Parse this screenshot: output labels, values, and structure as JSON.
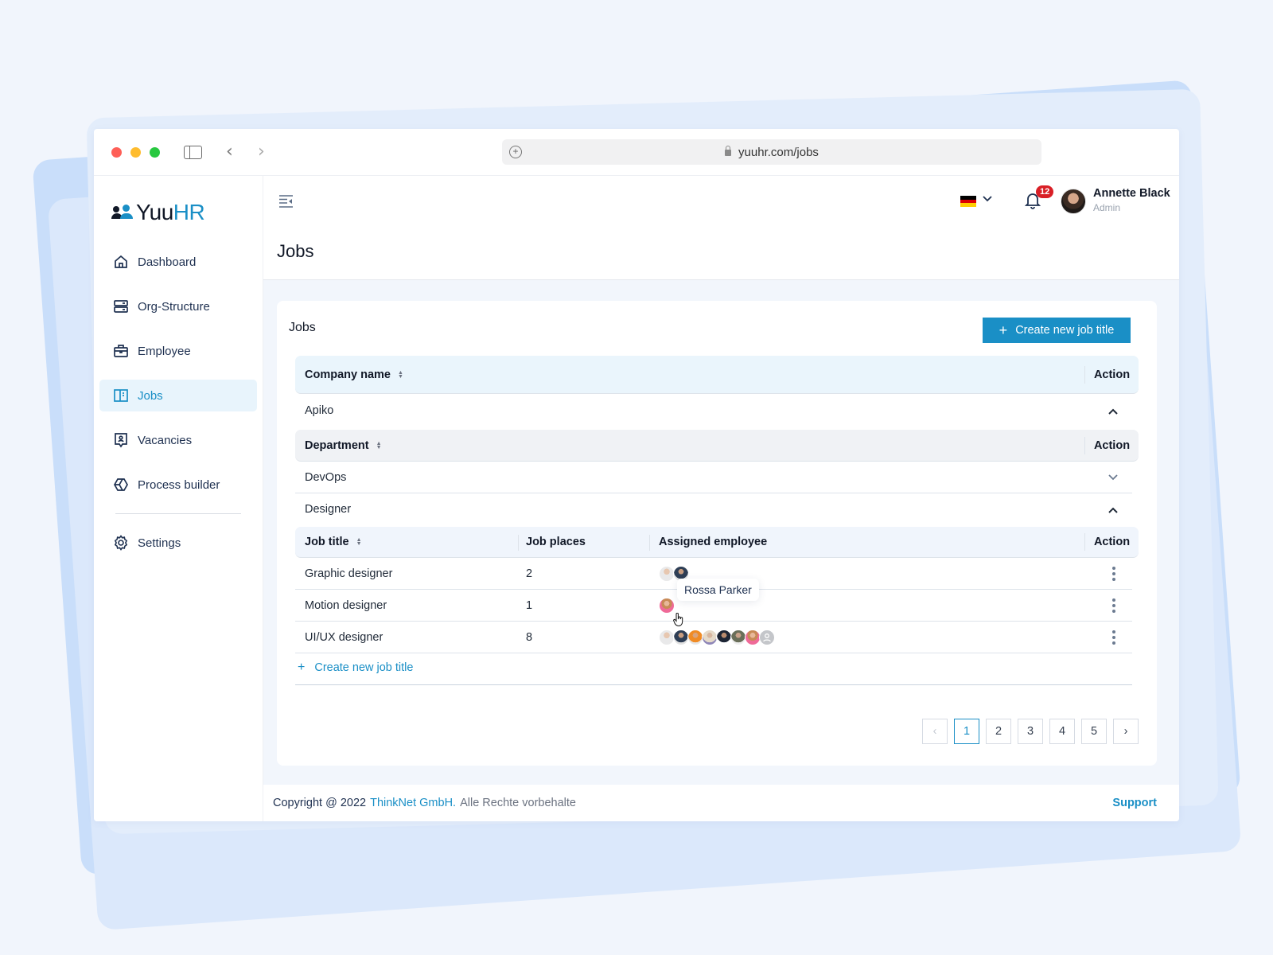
{
  "browser": {
    "url": "yuuhr.com/jobs"
  },
  "app": {
    "logo": {
      "part1": "Yuu",
      "part2": "HR"
    },
    "sidebar": {
      "items": [
        {
          "label": "Dashboard",
          "icon": "home-icon",
          "active": false
        },
        {
          "label": "Org-Structure",
          "icon": "server-icon",
          "active": false
        },
        {
          "label": "Employee",
          "icon": "briefcase-icon",
          "active": false
        },
        {
          "label": "Jobs",
          "icon": "book-open-icon",
          "active": true
        },
        {
          "label": "Vacancies",
          "icon": "user-board-icon",
          "active": false
        },
        {
          "label": "Process builder",
          "icon": "hexagon-icon",
          "active": false
        }
      ],
      "settings": {
        "label": "Settings",
        "icon": "gear-icon"
      }
    },
    "header": {
      "language": "DE",
      "flag_colors": [
        "#000000",
        "#dd0000",
        "#ffce00"
      ],
      "notifications_count": "12",
      "user": {
        "name": "Annette Black",
        "role": "Admin"
      },
      "page_title": "Jobs"
    },
    "card": {
      "title": "Jobs",
      "create_button": "Create new job title",
      "company_table": {
        "column": "Company name",
        "action": "Action",
        "rows": [
          {
            "name": "Apiko",
            "expanded": true
          }
        ]
      },
      "department_table": {
        "column": "Department",
        "action": "Action",
        "rows": [
          {
            "name": "DevOps",
            "expanded": false
          },
          {
            "name": "Designer",
            "expanded": true
          }
        ]
      },
      "jobs_table": {
        "columns": [
          "Job title",
          "Job places",
          "Assigned employee",
          "Action"
        ],
        "rows": [
          {
            "title": "Graphic designer",
            "places": "2",
            "assigned_count": 2
          },
          {
            "title": "Motion designer",
            "places": "1",
            "assigned_count": 1
          },
          {
            "title": "UI/UX designer",
            "places": "8",
            "assigned_count": 8
          }
        ]
      },
      "tooltip": "Rossa Parker",
      "add_link": "Create new job title",
      "pagination": {
        "pages": [
          "1",
          "2",
          "3",
          "4",
          "5"
        ],
        "current": "1",
        "prev": "‹",
        "next": "›"
      }
    },
    "footer": {
      "copyright": "Copyright @ 2022",
      "company": "ThinkNet GmbH.",
      "rights": "Alle Rechte vorbehalte",
      "support": "Support"
    }
  },
  "colors": {
    "accent": "#1a8fc6",
    "badge": "#d91f26",
    "active_bg": "#e8f4fc"
  }
}
